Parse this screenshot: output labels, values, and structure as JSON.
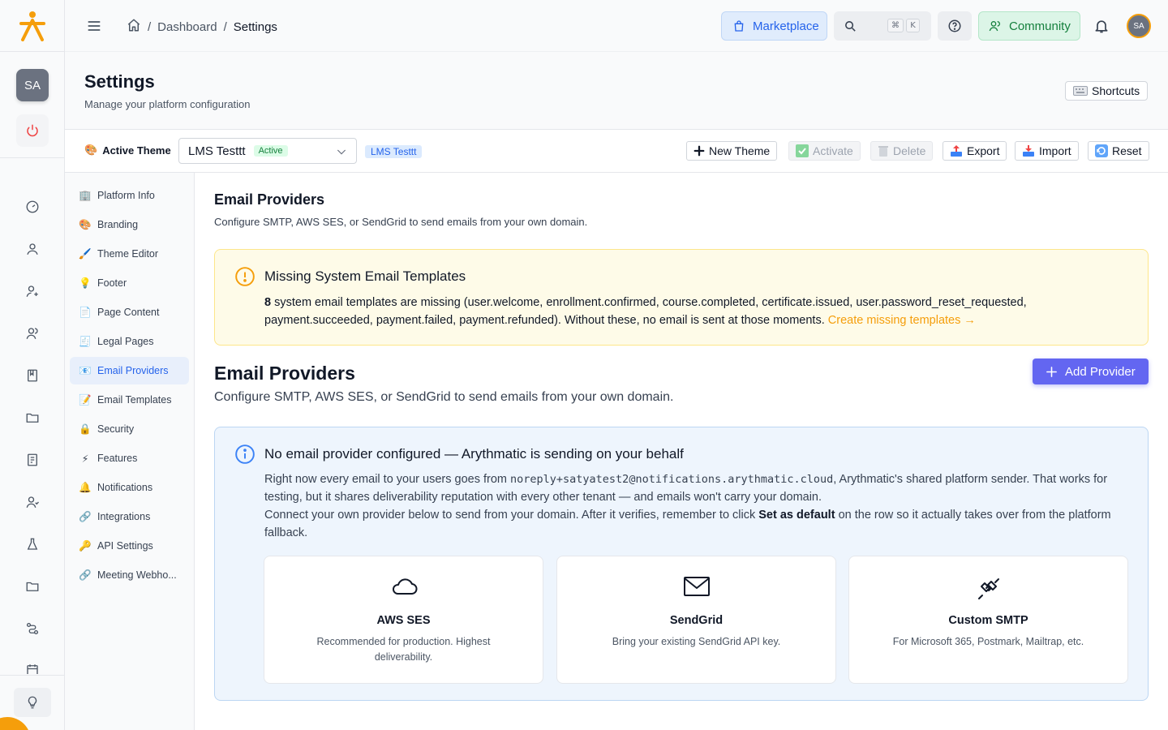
{
  "topbar": {
    "breadcrumb": {
      "home_icon": "home-icon",
      "dashboard": "Dashboard",
      "separator": "/",
      "current": "Settings"
    },
    "marketplace_label": "Marketplace",
    "search_kbd_mod": "⌘",
    "search_kbd_key": "K",
    "community_label": "Community",
    "avatar_initials": "SA"
  },
  "rail": {
    "avatar_initials": "SA",
    "icons": [
      "dashboard-gauge-icon",
      "user-icon",
      "user-plus-icon",
      "users-icon",
      "book-icon",
      "folder-icon",
      "report-icon",
      "users-group-icon",
      "flask-icon",
      "folder-icon",
      "route-icon",
      "calendar-icon",
      "lightbulb-icon"
    ]
  },
  "header": {
    "title": "Settings",
    "subtitle": "Manage your platform configuration",
    "shortcuts_label": "Shortcuts"
  },
  "themebar": {
    "label": "Active Theme",
    "selected_theme": "LMS Testtt",
    "active_badge": "Active",
    "theme_tag": "LMS Testtt",
    "buttons": {
      "new_theme": "New Theme",
      "activate": "Activate",
      "delete": "Delete",
      "export": "Export",
      "import": "Import",
      "reset": "Reset"
    }
  },
  "nav": {
    "items": [
      {
        "label": "Platform Info",
        "icon": "🏢"
      },
      {
        "label": "Branding",
        "icon": "🎨"
      },
      {
        "label": "Theme Editor",
        "icon": "🖌️"
      },
      {
        "label": "Footer",
        "icon": "💡"
      },
      {
        "label": "Page Content",
        "icon": "📄"
      },
      {
        "label": "Legal Pages",
        "icon": "🧾"
      },
      {
        "label": "Email Providers",
        "icon": "📧"
      },
      {
        "label": "Email Templates",
        "icon": "📝"
      },
      {
        "label": "Security",
        "icon": "🔒"
      },
      {
        "label": "Features",
        "icon": "⚡"
      },
      {
        "label": "Notifications",
        "icon": "🔔"
      },
      {
        "label": "Integrations",
        "icon": "🔗"
      },
      {
        "label": "API Settings",
        "icon": "🔑"
      },
      {
        "label": "Meeting Webho...",
        "icon": "🔗"
      }
    ],
    "active_index": 6
  },
  "main": {
    "section_title": "Email Providers",
    "section_subtitle": "Configure SMTP, AWS SES, or SendGrid to send emails from your own domain.",
    "warning": {
      "title": "Missing System Email Templates",
      "count": "8",
      "body": " system email templates are missing (user.welcome, enrollment.confirmed, course.completed, certificate.issued, user.password_reset_requested, payment.succeeded, payment.failed, payment.refunded). Without these, no email is sent at those moments. ",
      "link": "Create missing templates →"
    },
    "providers_title": "Email Providers",
    "providers_subtitle": "Configure SMTP, AWS SES, or SendGrid to send emails from your own domain.",
    "add_provider_label": "Add Provider",
    "info": {
      "title": "No email provider configured — Arythmatic is sending on your behalf",
      "p1_pre": "Right now every email to your users goes from ",
      "p1_email": "noreply+satyatest2@notifications.arythmatic.cloud",
      "p1_post": ", Arythmatic's shared platform sender. That works for testing, but it shares deliverability reputation with every other tenant — and emails won't carry your domain.",
      "p2_pre": "Connect your own provider below to send from your domain. After it verifies, remember to click ",
      "p2_bold": "Set as default",
      "p2_post": " on the row so it actually takes over from the platform fallback."
    },
    "cards": [
      {
        "title": "AWS SES",
        "desc": "Recommended for production. Highest deliverability.",
        "icon": "cloud-icon"
      },
      {
        "title": "SendGrid",
        "desc": "Bring your existing SendGrid API key.",
        "icon": "mail-icon"
      },
      {
        "title": "Custom SMTP",
        "desc": "For Microsoft 365, Postmark, Mailtrap, etc.",
        "icon": "plug-icon"
      }
    ]
  },
  "colors": {
    "brand": "#f59e0b",
    "primary": "#6366f1",
    "link": "#2563eb",
    "success": "#15803d"
  }
}
